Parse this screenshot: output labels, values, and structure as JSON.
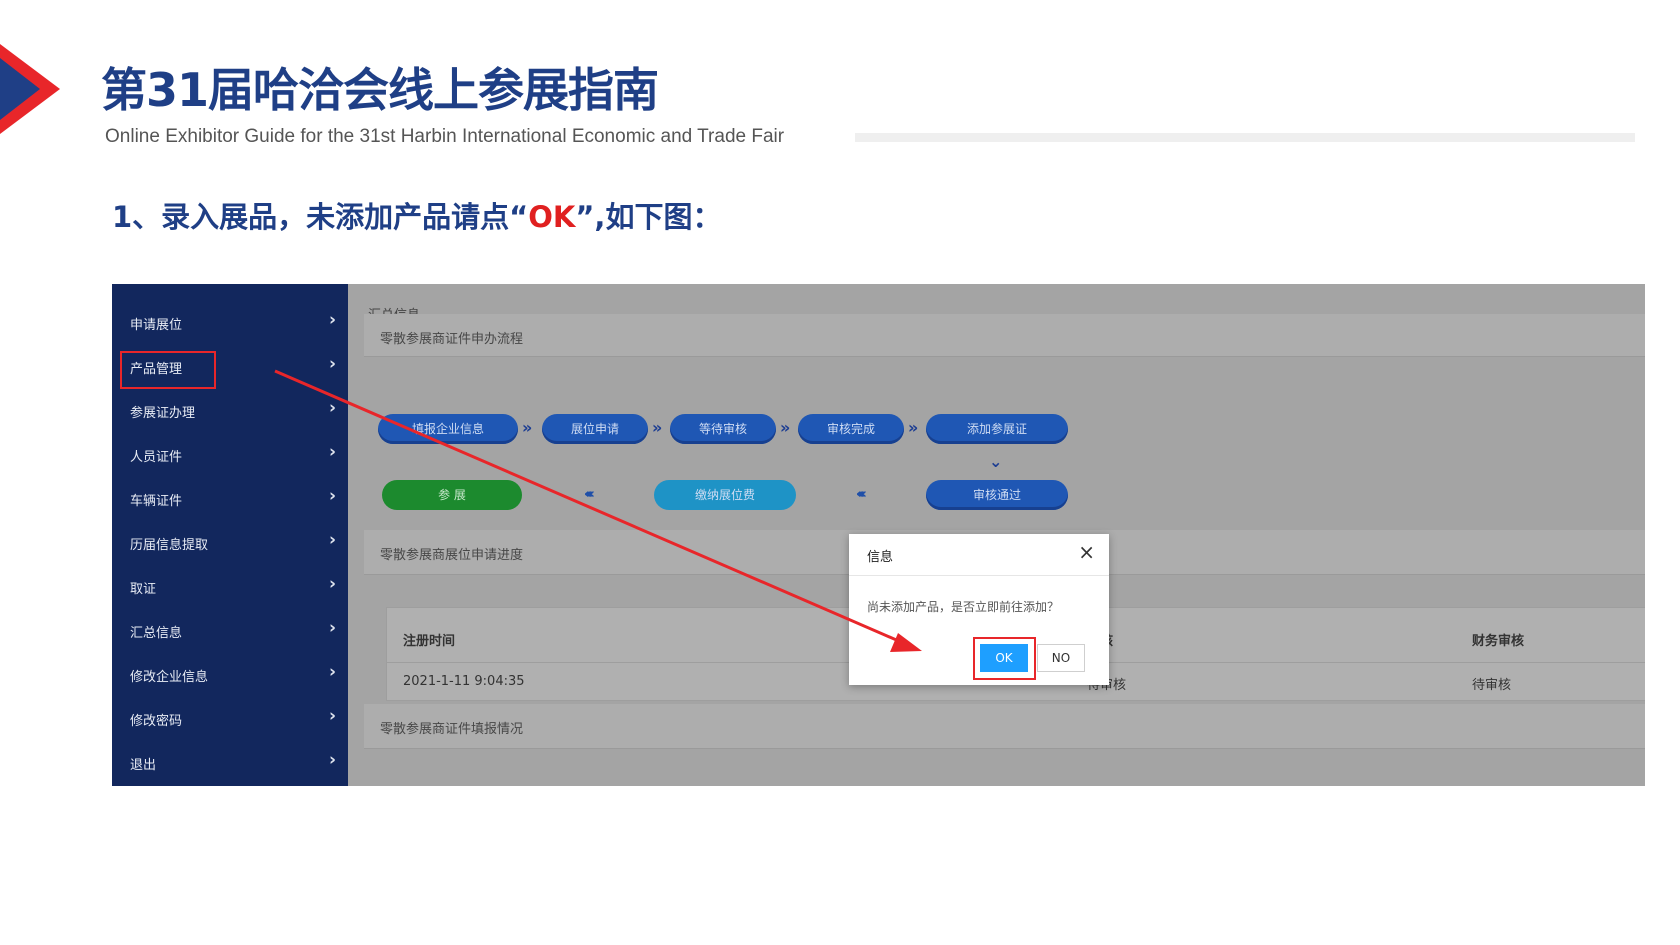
{
  "slide": {
    "title": "第31届哈洽会线上参展指南",
    "subtitle": "Online Exhibitor Guide for the 31st Harbin International Economic and Trade Fair",
    "step_prefix": "1、录入展品，未添加产品请点“",
    "step_ok": "OK",
    "step_suffix": "”,如下图："
  },
  "colors": {
    "title": "#1f3f86",
    "accent_red": "#e8262a",
    "sidebar_bg": "#12275d",
    "ok_button": "#1e9fff"
  },
  "sidebar": {
    "items": [
      {
        "label": "申请展位"
      },
      {
        "label": "产品管理"
      },
      {
        "label": "参展证办理"
      },
      {
        "label": "人员证件"
      },
      {
        "label": "车辆证件"
      },
      {
        "label": "历届信息提取"
      },
      {
        "label": "取证"
      },
      {
        "label": "汇总信息"
      },
      {
        "label": "修改企业信息"
      },
      {
        "label": "修改密码"
      },
      {
        "label": "退出"
      }
    ],
    "chevron": "›"
  },
  "main": {
    "breadcrumb": "汇总信息",
    "flow_panel_title": "零散参展商证件申办流程",
    "flow": {
      "row1": [
        "填报企业信息",
        "展位申请",
        "等待审核",
        "审核完成",
        "添加参展证"
      ],
      "row2_start": "参 展",
      "row2_mid": "缴纳展位费",
      "row2_end": "审核通过"
    },
    "progress_panel_title": "零散参展商展位申请进度",
    "table": {
      "headers": [
        "注册时间",
        "审核",
        "财务审核"
      ],
      "row": [
        "2021-1-11 9:04:35",
        "待审核",
        "待审核"
      ]
    },
    "cert_panel_title": "零散参展商证件填报情况"
  },
  "dialog": {
    "title": "信息",
    "close": "×",
    "message": "尚未添加产品，是否立即前往添加？",
    "ok_label": "OK",
    "no_label": "NO"
  }
}
